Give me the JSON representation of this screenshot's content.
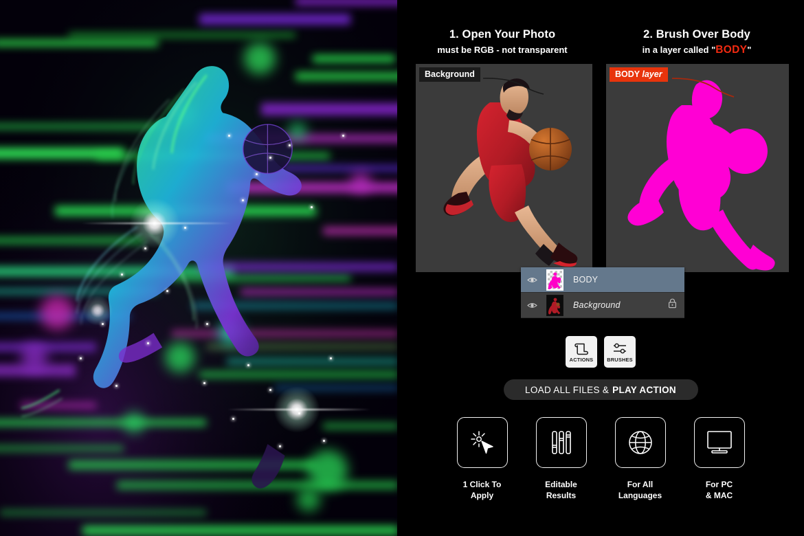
{
  "steps": [
    {
      "title": "1. Open Your Photo",
      "subtitle": "must be RGB - not transparent",
      "tag": "Background",
      "tag_icon": "background-label-badge"
    },
    {
      "title": "2. Brush Over Body",
      "subtitle_prefix": "in a layer called",
      "subtitle_quote_open": "\"",
      "subtitle_highlight": "BODY",
      "subtitle_quote_close": "\"",
      "tag_bold": "BODY",
      "tag_italic": "layer"
    }
  ],
  "layers_panel": {
    "rows": [
      {
        "name": "BODY",
        "selected": true,
        "locked": false,
        "visible": true,
        "thumb": "transparent-checker-magenta-silhouette"
      },
      {
        "name": "Background",
        "selected": false,
        "locked": true,
        "visible": true,
        "thumb": "dark-photo-thumbnail"
      }
    ]
  },
  "tool_buttons": [
    {
      "label": "ACTIONS",
      "icon": "scroll-icon"
    },
    {
      "label": "BRUSHES",
      "icon": "sliders-icon"
    }
  ],
  "load_button": {
    "text_regular": "LOAD ALL FILES &",
    "text_bold": "PLAY ACTION"
  },
  "features": [
    {
      "icon": "cursor-click-icon",
      "line1": "1 Click To",
      "line2": "Apply"
    },
    {
      "icon": "sliders-icon",
      "line1": "Editable",
      "line2": "Results"
    },
    {
      "icon": "globe-icon",
      "line1": "For All",
      "line2": "Languages"
    },
    {
      "icon": "monitor-icon",
      "line1": "For PC",
      "line2": "& MAC"
    }
  ],
  "colors": {
    "accent_red": "#e8340c",
    "body_red": "#f22a11",
    "magenta": "#ff00d4",
    "panel_bg": "#000000",
    "preview_bg": "#3b3b3b",
    "layer_selected": "#64788c",
    "layer_row": "#3f3f3f"
  },
  "artwork": {
    "subject": "neon-glitch-basketball-player",
    "jersey_color": "#c21f2b",
    "streak_palette": [
      "#2bd14a",
      "#19c7a0",
      "#7a2fd0",
      "#c02ec9",
      "#2b6fd8"
    ]
  }
}
